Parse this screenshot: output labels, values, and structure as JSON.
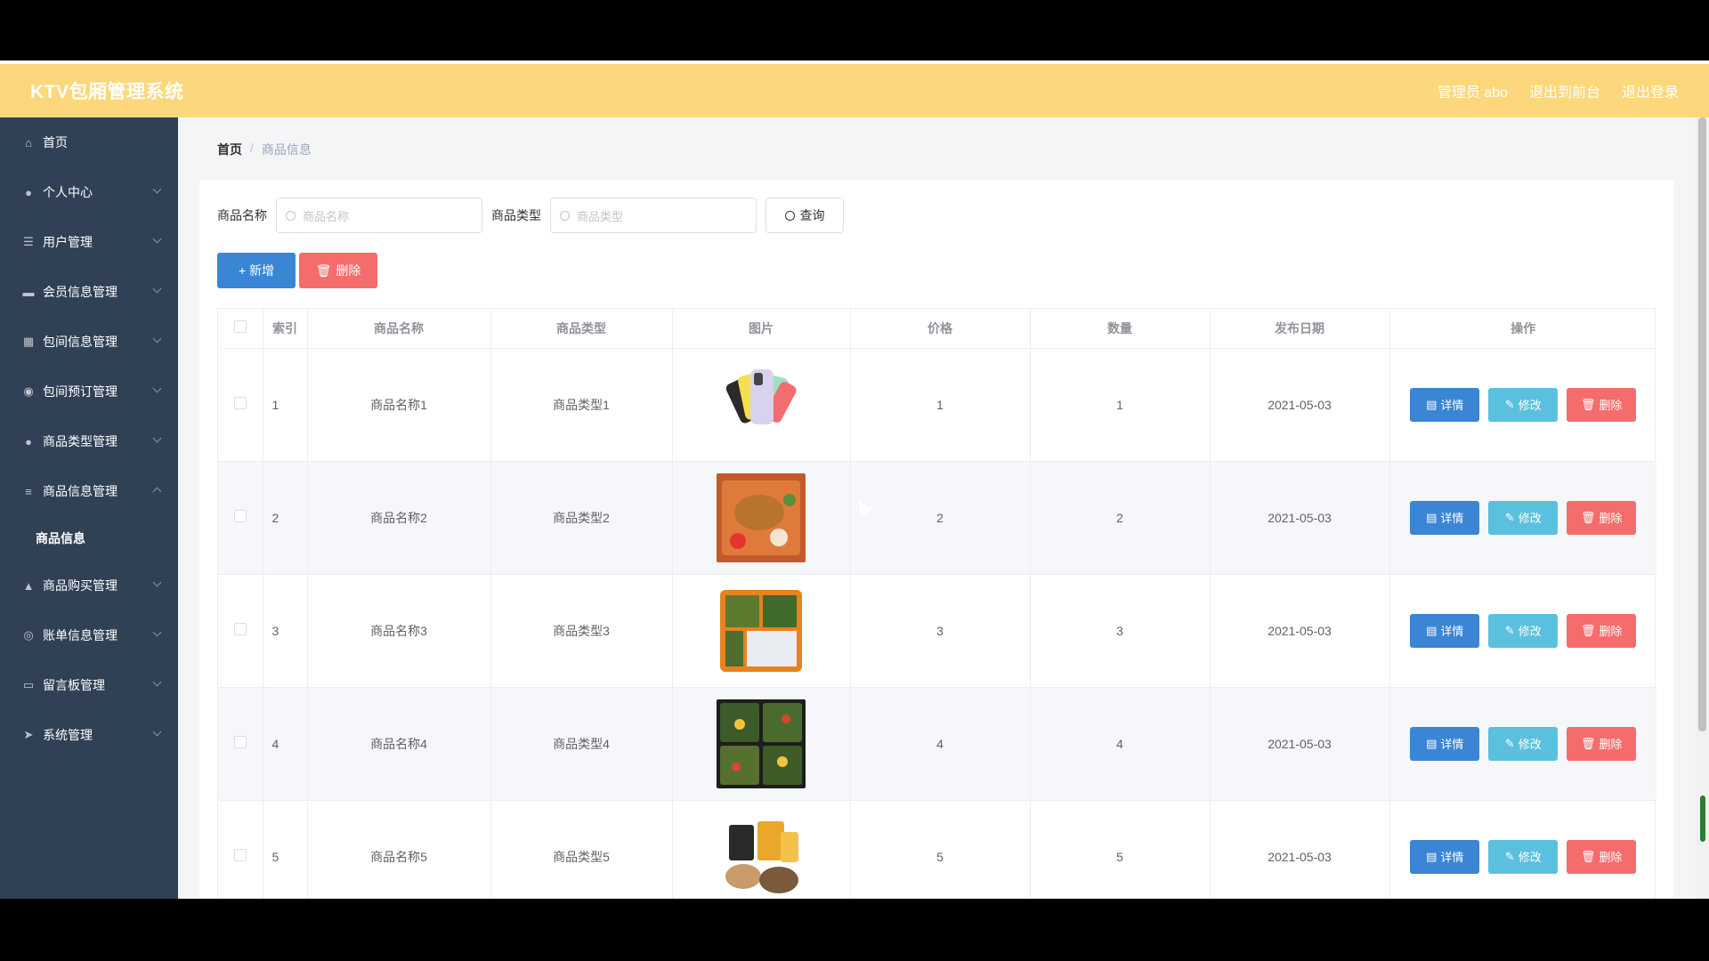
{
  "app": {
    "title": "KTV包厢管理系统"
  },
  "header": {
    "admin_label": "管理员 abo",
    "to_front": "退出到前台",
    "logout": "退出登录"
  },
  "sidebar": {
    "items": [
      {
        "label": "首页",
        "icon": "home-icon"
      },
      {
        "label": "个人中心",
        "icon": "user-icon"
      },
      {
        "label": "用户管理",
        "icon": "list-icon"
      },
      {
        "label": "会员信息管理",
        "icon": "monitor-icon"
      },
      {
        "label": "包间信息管理",
        "icon": "chart-icon"
      },
      {
        "label": "包间预订管理",
        "icon": "location-icon"
      },
      {
        "label": "商品类型管理",
        "icon": "user-icon"
      },
      {
        "label": "商品信息管理",
        "icon": "sliders-icon"
      },
      {
        "label": "商品信息",
        "icon": ""
      },
      {
        "label": "商品购买管理",
        "icon": "thumb-icon"
      },
      {
        "label": "账单信息管理",
        "icon": "globe-icon"
      },
      {
        "label": "留言板管理",
        "icon": "chat-icon"
      },
      {
        "label": "系统管理",
        "icon": "send-icon"
      }
    ]
  },
  "breadcrumb": {
    "home": "首页",
    "separator": "/",
    "current": "商品信息"
  },
  "search": {
    "name_label": "商品名称",
    "name_placeholder": "商品名称",
    "type_label": "商品类型",
    "type_placeholder": "商品类型",
    "query_button": "查询"
  },
  "actions": {
    "add": "+ 新增",
    "delete": "删除"
  },
  "table": {
    "headers": [
      "索引",
      "商品名称",
      "商品类型",
      "图片",
      "价格",
      "数量",
      "发布日期",
      "操作"
    ],
    "rows": [
      {
        "index": "1",
        "name": "商品名称1",
        "type": "商品类型1",
        "price": "1",
        "qty": "1",
        "date": "2021-05-03",
        "image": "phones"
      },
      {
        "index": "2",
        "name": "商品名称2",
        "type": "商品类型2",
        "price": "2",
        "qty": "2",
        "date": "2021-05-03",
        "image": "fried-chicken-box"
      },
      {
        "index": "3",
        "name": "商品名称3",
        "type": "商品类型3",
        "price": "3",
        "qty": "3",
        "date": "2021-05-03",
        "image": "bento-box"
      },
      {
        "index": "4",
        "name": "商品名称4",
        "type": "商品类型4",
        "price": "4",
        "qty": "4",
        "date": "2021-05-03",
        "image": "salad-boxes"
      },
      {
        "index": "5",
        "name": "商品名称5",
        "type": "商品类型5",
        "price": "5",
        "qty": "5",
        "date": "2021-05-03",
        "image": "snacks"
      }
    ],
    "op_detail": "详情",
    "op_edit": "修改",
    "op_delete": "删除"
  },
  "colors": {
    "header": "#fdd77b",
    "sidebar": "#304156",
    "primary": "#3a85d4",
    "info": "#5bc0de",
    "danger": "#f56c6c"
  }
}
